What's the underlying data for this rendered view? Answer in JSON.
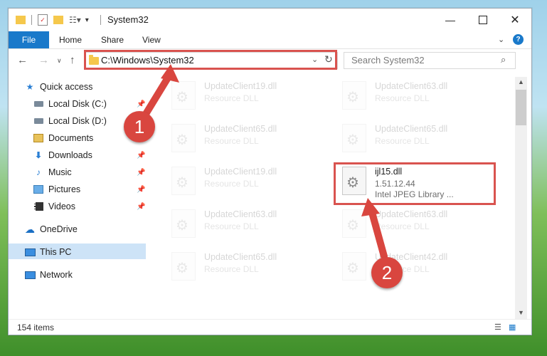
{
  "window": {
    "title": "System32",
    "controls": [
      "minimize-icon",
      "maximize-icon",
      "close-icon"
    ]
  },
  "ribbon": {
    "tabs": [
      "File",
      "Home",
      "Share",
      "View"
    ]
  },
  "address": {
    "path": "C:\\Windows\\System32",
    "search_placeholder": "Search System32"
  },
  "sidebar": {
    "items": [
      {
        "label": "Quick access",
        "icon": "star-icon"
      },
      {
        "label": "Local Disk (C:)",
        "icon": "drive-icon"
      },
      {
        "label": "Local Disk (D:)",
        "icon": "drive-icon"
      },
      {
        "label": "Documents",
        "icon": "documents-icon"
      },
      {
        "label": "Downloads",
        "icon": "download-icon"
      },
      {
        "label": "Music",
        "icon": "music-icon"
      },
      {
        "label": "Pictures",
        "icon": "pictures-icon"
      },
      {
        "label": "Videos",
        "icon": "videos-icon"
      },
      {
        "label": "OneDrive",
        "icon": "cloud-icon"
      },
      {
        "label": "This PC",
        "icon": "computer-icon"
      },
      {
        "label": "Network",
        "icon": "network-icon"
      }
    ]
  },
  "files": [
    {
      "name": "UpdateClient19.dll",
      "type": "Resource DLL"
    },
    {
      "name": "UpdateClient63.dll",
      "type": "Resource DLL"
    },
    {
      "name": "UpdateClient65.dll",
      "type": "Resource DLL"
    },
    {
      "name": "UpdateClient65.dll",
      "type": "Resource DLL"
    },
    {
      "name": "UpdateClient19.dll",
      "type": "Resource DLL"
    },
    {
      "name": "ijl15.dll",
      "version": "1.51.12.44",
      "description": "Intel JPEG Library ..."
    },
    {
      "name": "UpdateClient63.dll",
      "type": "Resource DLL"
    },
    {
      "name": "UpdateClient63.dll",
      "type": "Resource DLL"
    },
    {
      "name": "UpdateClient65.dll",
      "type": "Resource DLL"
    },
    {
      "name": "UpdateClient42.dll",
      "type": "Resource DLL"
    }
  ],
  "status": {
    "item_count": "154 items"
  },
  "annotations": {
    "step1": "1",
    "step2": "2",
    "highlight_color": "#d9463f"
  }
}
